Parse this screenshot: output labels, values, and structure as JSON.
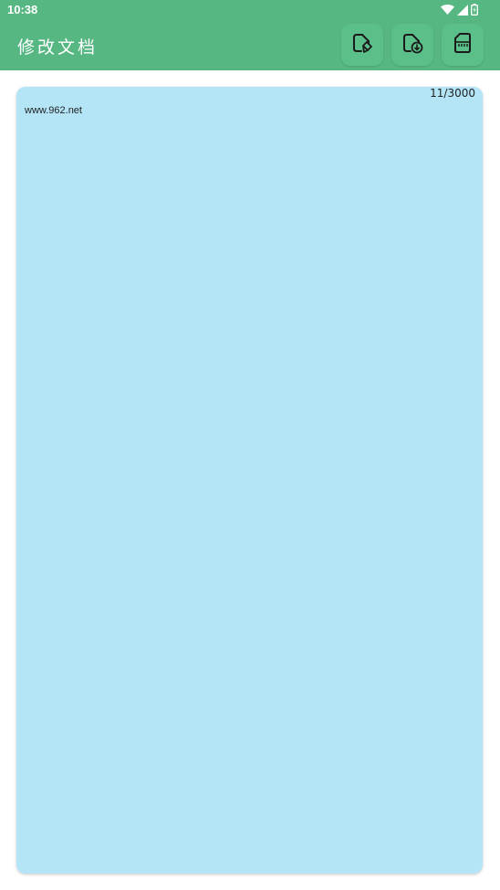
{
  "status_bar": {
    "time": "10:38",
    "icons": [
      "wifi-icon",
      "cellular-signal-icon",
      "battery-icon"
    ]
  },
  "app_bar": {
    "title": "修改文档",
    "background_color": "#57b782",
    "actions": [
      {
        "icon": "save-document-icon"
      },
      {
        "icon": "download-document-icon"
      },
      {
        "icon": "sd-card-icon"
      }
    ]
  },
  "editor": {
    "background_color": "#b4e5f7",
    "char_count": "11/3000",
    "content": "www.962.net"
  }
}
